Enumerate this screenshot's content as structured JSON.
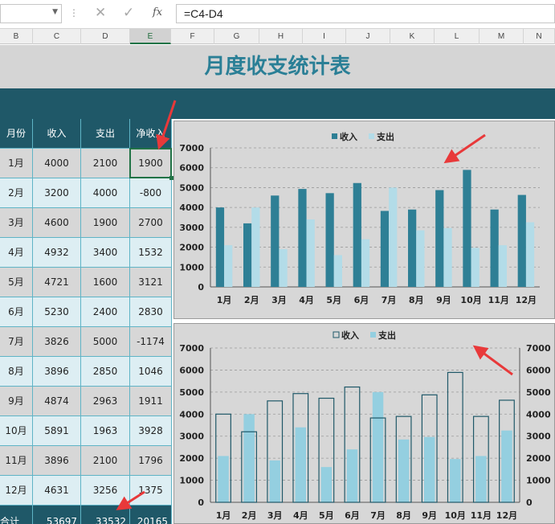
{
  "formula_bar": {
    "formula": "=C4-D4",
    "dots_glyph": "⋮",
    "cancel_glyph": "✕",
    "enter_glyph": "✓",
    "fx_label": "fx"
  },
  "columns": [
    "B",
    "C",
    "D",
    "E",
    "F",
    "G",
    "H",
    "I",
    "J",
    "K",
    "L",
    "M",
    "N"
  ],
  "title": "月度收支统计表",
  "table": {
    "headers": [
      "月份",
      "收入",
      "支出",
      "净收入"
    ],
    "rows": [
      [
        "1月",
        "4000",
        "2100",
        "1900"
      ],
      [
        "2月",
        "3200",
        "4000",
        "-800"
      ],
      [
        "3月",
        "4600",
        "1900",
        "2700"
      ],
      [
        "4月",
        "4932",
        "3400",
        "1532"
      ],
      [
        "5月",
        "4721",
        "1600",
        "3121"
      ],
      [
        "6月",
        "5230",
        "2400",
        "2830"
      ],
      [
        "7月",
        "3826",
        "5000",
        "-1174"
      ],
      [
        "8月",
        "3896",
        "2850",
        "1046"
      ],
      [
        "9月",
        "4874",
        "2963",
        "1911"
      ],
      [
        "10月",
        "5891",
        "1963",
        "3928"
      ],
      [
        "11月",
        "3896",
        "2100",
        "1796"
      ],
      [
        "12月",
        "4631",
        "3256",
        "1375"
      ]
    ],
    "total": [
      "合计",
      "53697",
      "33532",
      "20165"
    ]
  },
  "colors": {
    "income": "#2e7f95",
    "expense": "#b3dce8",
    "expense_fill2": "#94cfe0",
    "outline": "#1f5868",
    "accent_red": "#e8393a"
  },
  "chart_data": [
    {
      "type": "bar",
      "categories": [
        "1月",
        "2月",
        "3月",
        "4月",
        "5月",
        "6月",
        "7月",
        "8月",
        "9月",
        "10月",
        "11月",
        "12月"
      ],
      "series": [
        {
          "name": "收入",
          "values": [
            4000,
            3200,
            4600,
            4932,
            4721,
            5230,
            3826,
            3896,
            4874,
            5891,
            3896,
            4631
          ]
        },
        {
          "name": "支出",
          "values": [
            2100,
            4000,
            1900,
            3400,
            1600,
            2400,
            5000,
            2850,
            2963,
            1963,
            2100,
            3256
          ]
        }
      ],
      "ylim": [
        0,
        7000
      ],
      "yticks": [
        0,
        1000,
        2000,
        3000,
        4000,
        5000,
        6000,
        7000
      ],
      "grid": true,
      "legend": "top"
    },
    {
      "type": "bar",
      "style": "overlapped outline bars",
      "categories": [
        "1月",
        "2月",
        "3月",
        "4月",
        "5月",
        "6月",
        "7月",
        "8月",
        "9月",
        "10月",
        "11月",
        "12月"
      ],
      "series": [
        {
          "name": "收入",
          "values": [
            4000,
            3200,
            4600,
            4932,
            4721,
            5230,
            3826,
            3896,
            4874,
            5891,
            3896,
            4631
          ]
        },
        {
          "name": "支出",
          "values": [
            2100,
            4000,
            1900,
            3400,
            1600,
            2400,
            5000,
            2850,
            2963,
            1963,
            2100,
            3256
          ]
        }
      ],
      "ylim": [
        0,
        7000
      ],
      "yticks": [
        0,
        1000,
        2000,
        3000,
        4000,
        5000,
        6000,
        7000
      ],
      "secondary_axis": true,
      "grid": true,
      "legend": "top"
    }
  ]
}
